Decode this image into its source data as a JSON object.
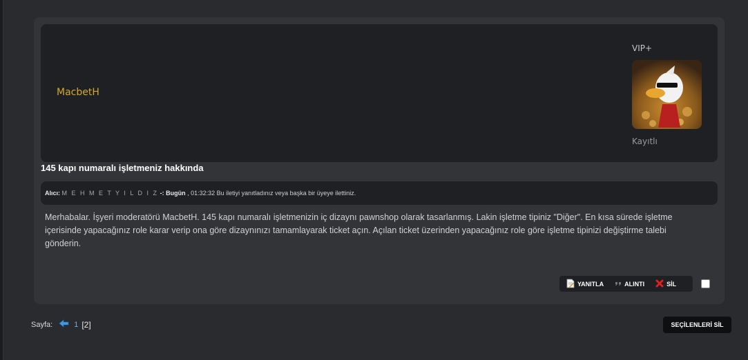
{
  "post": {
    "author": "MacbetH",
    "rank": "VIP+",
    "reg_status": "Kayıtlı",
    "subject": "145 kapı numaralı işletmeniz hakkında",
    "meta": {
      "recipient_label": "Alıcı:",
      "recipient": "M E H M E T Y I L D I Z",
      "separator": " -: ",
      "date_label": "Bugün",
      "time_text": ", 01:32:32 Bu iletiyi yanıtladınız veya başka bir üyeye ilettiniz."
    },
    "message": "Merhabalar. İşyeri moderatörü MacbetH. 145 kapı numaralı işletmenizin iç dizaynı pawnshop olarak tasarlanmış. Lakin işletme tipiniz \"Diğer\". En kısa sürede işletme içerisinde yapacağınız role karar verip ona göre dizaynınızı tamamlayarak ticket açın. Açılan ticket üzerinden yapacağınız role göre işletme tipinizi değiştirme talebi gönderin.",
    "actions": {
      "reply": "YANITLA",
      "quote": "ALINTI",
      "delete": "SİL"
    }
  },
  "pagination": {
    "label": "Sayfa:",
    "page_link": "1",
    "current": "[2]"
  },
  "delete_selected": "SEÇİLENLERİ SİL",
  "icons": {
    "reply": "document-pencil-icon",
    "quote": "quote-icon",
    "delete": "red-x-icon",
    "prev": "blue-left-arrow-icon"
  },
  "colors": {
    "username": "#d4a92b",
    "page_link": "#7fa7d6"
  }
}
